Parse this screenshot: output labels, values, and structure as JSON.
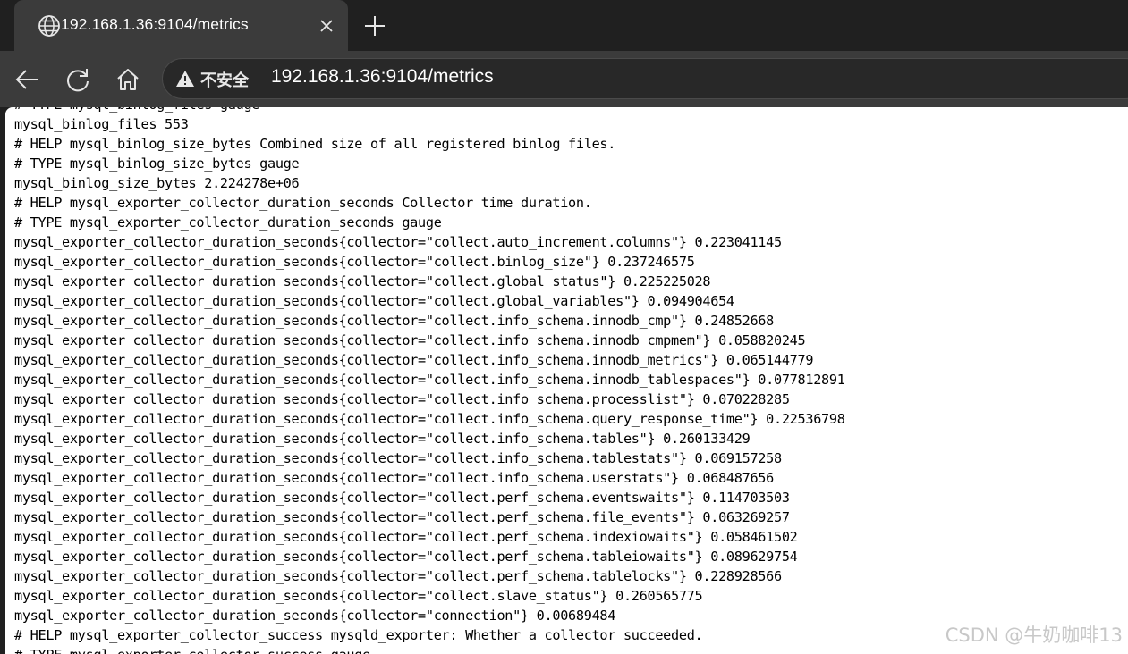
{
  "tab": {
    "title": "192.168.1.36:9104/metrics",
    "icon": "globe-icon"
  },
  "toolbar": {
    "security_label": "不安全",
    "url": "192.168.1.36:9104/metrics"
  },
  "colors": {
    "frame": "#202020",
    "tab_active": "#3b3b3b",
    "omnibox": "#282828",
    "page_bg": "#ffffff"
  },
  "metrics_lines": [
    "# TYPE mysql_binlog_files gauge",
    "mysql_binlog_files 553",
    "# HELP mysql_binlog_size_bytes Combined size of all registered binlog files.",
    "# TYPE mysql_binlog_size_bytes gauge",
    "mysql_binlog_size_bytes 2.224278e+06",
    "# HELP mysql_exporter_collector_duration_seconds Collector time duration.",
    "# TYPE mysql_exporter_collector_duration_seconds gauge",
    "mysql_exporter_collector_duration_seconds{collector=\"collect.auto_increment.columns\"} 0.223041145",
    "mysql_exporter_collector_duration_seconds{collector=\"collect.binlog_size\"} 0.237246575",
    "mysql_exporter_collector_duration_seconds{collector=\"collect.global_status\"} 0.225225028",
    "mysql_exporter_collector_duration_seconds{collector=\"collect.global_variables\"} 0.094904654",
    "mysql_exporter_collector_duration_seconds{collector=\"collect.info_schema.innodb_cmp\"} 0.24852668",
    "mysql_exporter_collector_duration_seconds{collector=\"collect.info_schema.innodb_cmpmem\"} 0.058820245",
    "mysql_exporter_collector_duration_seconds{collector=\"collect.info_schema.innodb_metrics\"} 0.065144779",
    "mysql_exporter_collector_duration_seconds{collector=\"collect.info_schema.innodb_tablespaces\"} 0.077812891",
    "mysql_exporter_collector_duration_seconds{collector=\"collect.info_schema.processlist\"} 0.070228285",
    "mysql_exporter_collector_duration_seconds{collector=\"collect.info_schema.query_response_time\"} 0.22536798",
    "mysql_exporter_collector_duration_seconds{collector=\"collect.info_schema.tables\"} 0.260133429",
    "mysql_exporter_collector_duration_seconds{collector=\"collect.info_schema.tablestats\"} 0.069157258",
    "mysql_exporter_collector_duration_seconds{collector=\"collect.info_schema.userstats\"} 0.068487656",
    "mysql_exporter_collector_duration_seconds{collector=\"collect.perf_schema.eventswaits\"} 0.114703503",
    "mysql_exporter_collector_duration_seconds{collector=\"collect.perf_schema.file_events\"} 0.063269257",
    "mysql_exporter_collector_duration_seconds{collector=\"collect.perf_schema.indexiowaits\"} 0.058461502",
    "mysql_exporter_collector_duration_seconds{collector=\"collect.perf_schema.tableiowaits\"} 0.089629754",
    "mysql_exporter_collector_duration_seconds{collector=\"collect.perf_schema.tablelocks\"} 0.228928566",
    "mysql_exporter_collector_duration_seconds{collector=\"collect.slave_status\"} 0.260565775",
    "mysql_exporter_collector_duration_seconds{collector=\"connection\"} 0.00689484",
    "# HELP mysql_exporter_collector_success mysqld_exporter: Whether a collector succeeded.",
    "# TYPE mysql_exporter_collector_success gauge"
  ],
  "watermark": "CSDN @牛奶咖啡13"
}
